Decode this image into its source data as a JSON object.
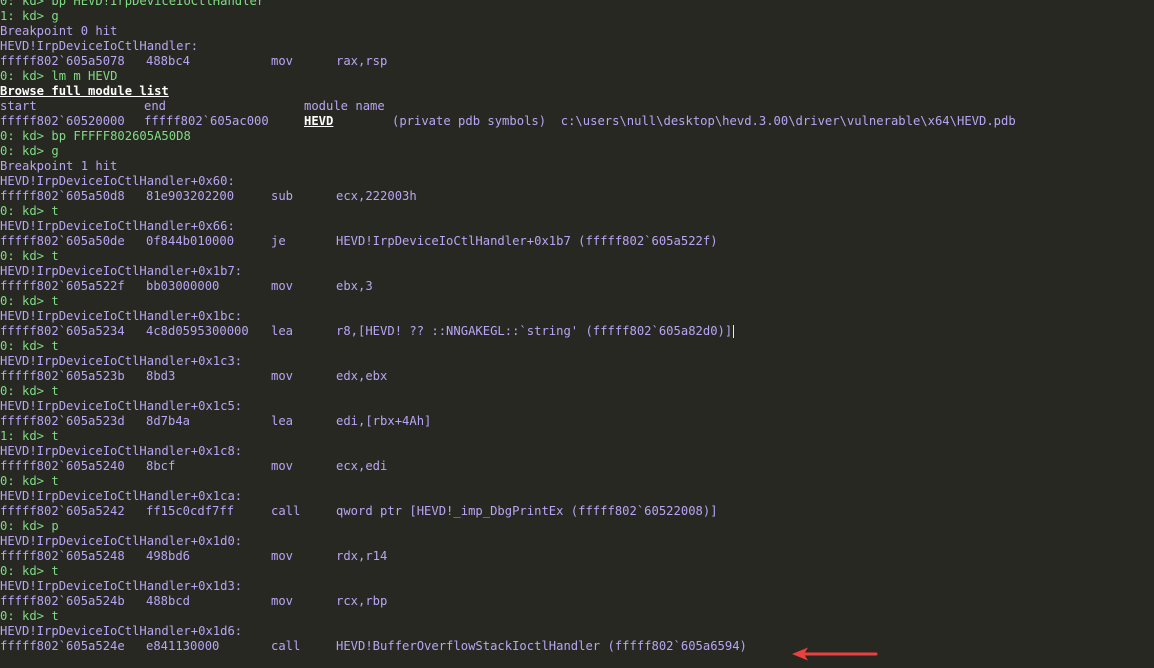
{
  "window": {
    "background": "#272822",
    "prompt_color": "#7fdc84",
    "output_color": "#b9a5f5",
    "link_color": "#ffffff",
    "arrow_color": "#e8413f"
  },
  "debugger": {
    "lines": [
      {
        "kind": "cmd",
        "prompt": "0: kd>",
        "text": "bp HEVD!IrpDeviceIoCtlHandler"
      },
      {
        "kind": "cmd",
        "prompt": "1: kd>",
        "text": "g"
      },
      {
        "kind": "text",
        "text": "Breakpoint 0 hit"
      },
      {
        "kind": "text",
        "text": "HEVD!IrpDeviceIoCtlHandler:"
      },
      {
        "kind": "asm",
        "addr": "fffff802`605a5078",
        "bytes": "488bc4",
        "mnem": "mov",
        "ops": "rax,rsp"
      },
      {
        "kind": "cmd",
        "prompt": "0: kd>",
        "text": "lm m HEVD"
      },
      {
        "kind": "link",
        "text": "Browse full module list"
      },
      {
        "kind": "header",
        "start": "start",
        "end": "end",
        "name": "module name"
      },
      {
        "kind": "module",
        "start": "fffff802`60520000",
        "end": "fffff802`605ac000",
        "mod": "HEVD",
        "rest": "(private pdb symbols)  c:\\users\\null\\desktop\\hevd.3.00\\driver\\vulnerable\\x64\\HEVD.pdb"
      },
      {
        "kind": "cmd",
        "prompt": "0: kd>",
        "text": "bp FFFFF802605A50D8"
      },
      {
        "kind": "cmd",
        "prompt": "0: kd>",
        "text": "g"
      },
      {
        "kind": "text",
        "text": "Breakpoint 1 hit"
      },
      {
        "kind": "text",
        "text": "HEVD!IrpDeviceIoCtlHandler+0x60:"
      },
      {
        "kind": "asm",
        "addr": "fffff802`605a50d8",
        "bytes": "81e903202200",
        "mnem": "sub",
        "ops": "ecx,222003h"
      },
      {
        "kind": "cmd",
        "prompt": "0: kd>",
        "text": "t"
      },
      {
        "kind": "text",
        "text": "HEVD!IrpDeviceIoCtlHandler+0x66:"
      },
      {
        "kind": "asm",
        "addr": "fffff802`605a50de",
        "bytes": "0f844b010000",
        "mnem": "je",
        "ops": "HEVD!IrpDeviceIoCtlHandler+0x1b7 (fffff802`605a522f)"
      },
      {
        "kind": "cmd",
        "prompt": "0: kd>",
        "text": "t"
      },
      {
        "kind": "text",
        "text": "HEVD!IrpDeviceIoCtlHandler+0x1b7:"
      },
      {
        "kind": "asm",
        "addr": "fffff802`605a522f",
        "bytes": "bb03000000",
        "mnem": "mov",
        "ops": "ebx,3"
      },
      {
        "kind": "cmd",
        "prompt": "0: kd>",
        "text": "t"
      },
      {
        "kind": "text",
        "text": "HEVD!IrpDeviceIoCtlHandler+0x1bc:"
      },
      {
        "kind": "asm",
        "addr": "fffff802`605a5234",
        "bytes": "4c8d0595300000",
        "mnem": "lea",
        "ops": "r8,[HEVD! ?? ::NNGAKEGL::`string' (fffff802`605a82d0)]",
        "cursor": true
      },
      {
        "kind": "cmd",
        "prompt": "0: kd>",
        "text": "t"
      },
      {
        "kind": "text",
        "text": "HEVD!IrpDeviceIoCtlHandler+0x1c3:"
      },
      {
        "kind": "asm",
        "addr": "fffff802`605a523b",
        "bytes": "8bd3",
        "mnem": "mov",
        "ops": "edx,ebx"
      },
      {
        "kind": "cmd",
        "prompt": "0: kd>",
        "text": "t"
      },
      {
        "kind": "text",
        "text": "HEVD!IrpDeviceIoCtlHandler+0x1c5:"
      },
      {
        "kind": "asm",
        "addr": "fffff802`605a523d",
        "bytes": "8d7b4a",
        "mnem": "lea",
        "ops": "edi,[rbx+4Ah]"
      },
      {
        "kind": "cmd",
        "prompt": "1: kd>",
        "text": "t"
      },
      {
        "kind": "text",
        "text": "HEVD!IrpDeviceIoCtlHandler+0x1c8:"
      },
      {
        "kind": "asm",
        "addr": "fffff802`605a5240",
        "bytes": "8bcf",
        "mnem": "mov",
        "ops": "ecx,edi"
      },
      {
        "kind": "cmd",
        "prompt": "0: kd>",
        "text": "t"
      },
      {
        "kind": "text",
        "text": "HEVD!IrpDeviceIoCtlHandler+0x1ca:"
      },
      {
        "kind": "asm",
        "addr": "fffff802`605a5242",
        "bytes": "ff15c0cdf7ff",
        "mnem": "call",
        "ops": "qword ptr [HEVD!_imp_DbgPrintEx (fffff802`60522008)]"
      },
      {
        "kind": "cmd",
        "prompt": "0: kd>",
        "text": "p"
      },
      {
        "kind": "text",
        "text": "HEVD!IrpDeviceIoCtlHandler+0x1d0:"
      },
      {
        "kind": "asm",
        "addr": "fffff802`605a5248",
        "bytes": "498bd6",
        "mnem": "mov",
        "ops": "rdx,r14"
      },
      {
        "kind": "cmd",
        "prompt": "0: kd>",
        "text": "t"
      },
      {
        "kind": "text",
        "text": "HEVD!IrpDeviceIoCtlHandler+0x1d3:"
      },
      {
        "kind": "asm",
        "addr": "fffff802`605a524b",
        "bytes": "488bcd",
        "mnem": "mov",
        "ops": "rcx,rbp"
      },
      {
        "kind": "cmd",
        "prompt": "0: kd>",
        "text": "t"
      },
      {
        "kind": "text",
        "text": "HEVD!IrpDeviceIoCtlHandler+0x1d6:"
      },
      {
        "kind": "asm",
        "addr": "fffff802`605a524e",
        "bytes": "e841130000",
        "mnem": "call",
        "ops": "HEVD!BufferOverflowStackIoctlHandler (fffff802`605a6594)"
      }
    ]
  }
}
